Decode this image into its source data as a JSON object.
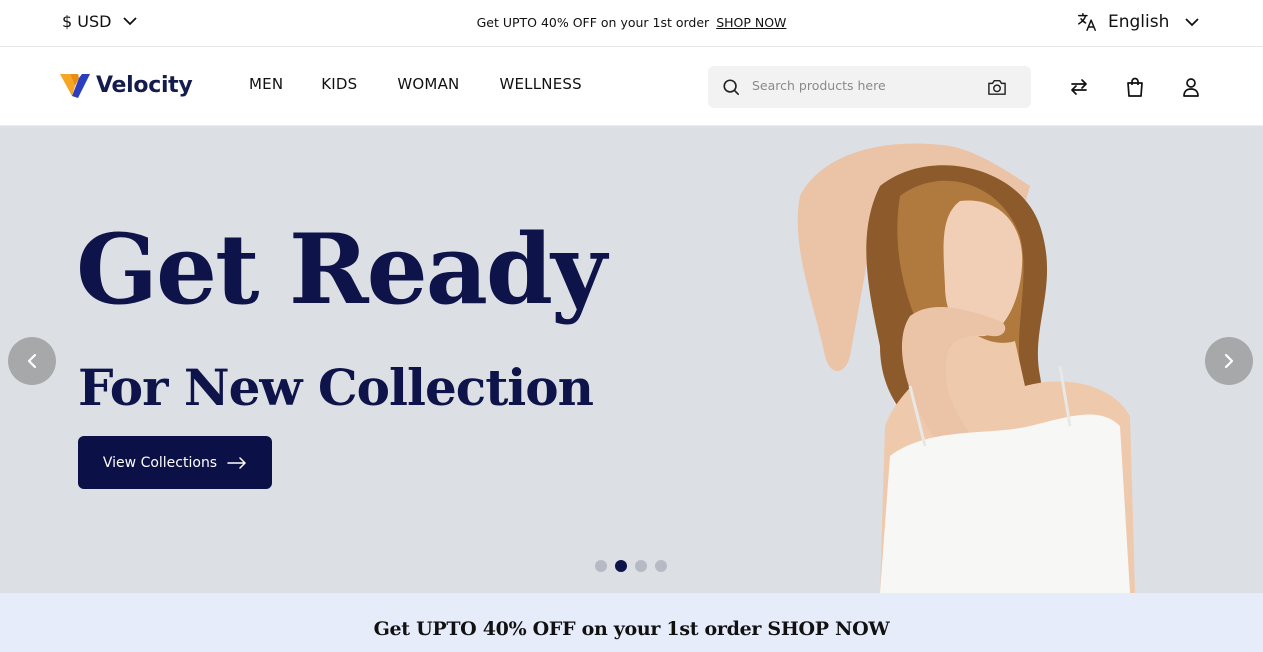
{
  "topbar": {
    "currency": "$ USD",
    "promo_text": "Get UPTO 40% OFF on your 1st order",
    "promo_link": "SHOP NOW",
    "language": "English"
  },
  "header": {
    "logo_text": "Velocity",
    "nav": [
      "MEN",
      "KIDS",
      "WOMAN",
      "WELLNESS"
    ],
    "search_placeholder": "Search products here"
  },
  "hero": {
    "title": "Get Ready",
    "subtitle": "For New Collection",
    "cta_label": "View Collections",
    "slides_total": 4,
    "active_slide": 2
  },
  "banner": {
    "text": "Get UPTO 40% OFF on your 1st order SHOP NOW"
  },
  "colors": {
    "navy": "#0e1449",
    "hero_bg": "#dcdfe4",
    "banner_bg": "#e7ecfb",
    "logo_orange": "#f5a623"
  }
}
